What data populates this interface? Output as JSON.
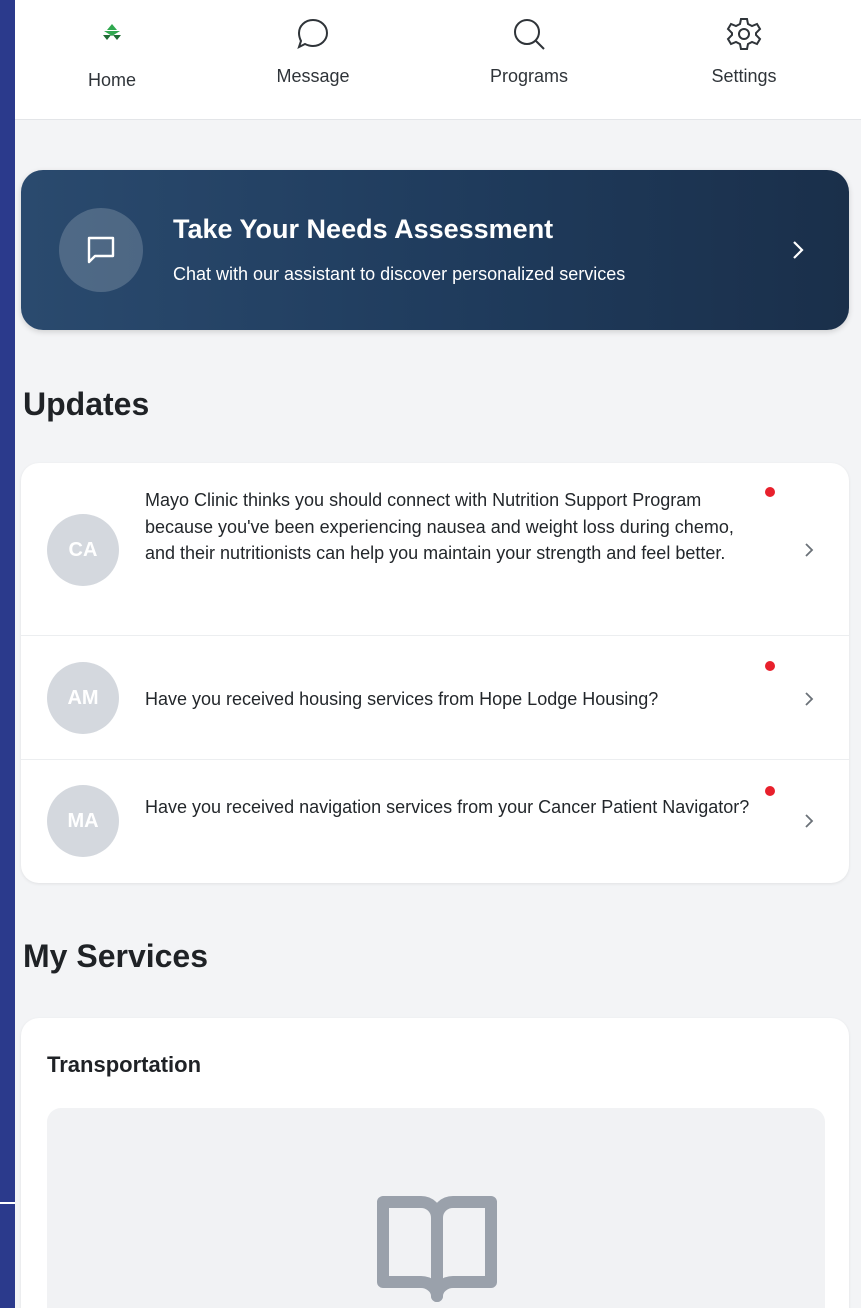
{
  "nav": {
    "items": [
      {
        "label": "Home",
        "icon": "logo-icon",
        "active": true
      },
      {
        "label": "Message",
        "icon": "chat-bubble-icon"
      },
      {
        "label": "Programs",
        "icon": "search-icon"
      },
      {
        "label": "Settings",
        "icon": "gear-icon"
      }
    ]
  },
  "banner": {
    "title": "Take Your Needs Assessment",
    "subtitle": "Chat with our assistant to discover personalized services",
    "icon": "message-square-icon"
  },
  "updates": {
    "heading": "Updates",
    "items": [
      {
        "initials": "CA",
        "text": "Mayo Clinic thinks you should connect with Nutrition Support Program because you've been experiencing nausea and weight loss during chemo, and their nutritionists can help you maintain your strength and feel better.",
        "unread": true
      },
      {
        "initials": "AM",
        "text": "Have you received housing services from Hope Lodge Housing?",
        "unread": true
      },
      {
        "initials": "MA",
        "text": "Have you received navigation services from your Cancer Patient Navigator?",
        "unread": true
      }
    ]
  },
  "services": {
    "heading": "My Services",
    "card_title": "Transportation",
    "placeholder_icon": "book-open-icon"
  },
  "colors": {
    "frame": "#2b3a8c",
    "banner_start": "#2a4a6e",
    "banner_end": "#1a2f4a",
    "unread_dot": "#e8202c",
    "logo_green": "#2fa84f"
  }
}
